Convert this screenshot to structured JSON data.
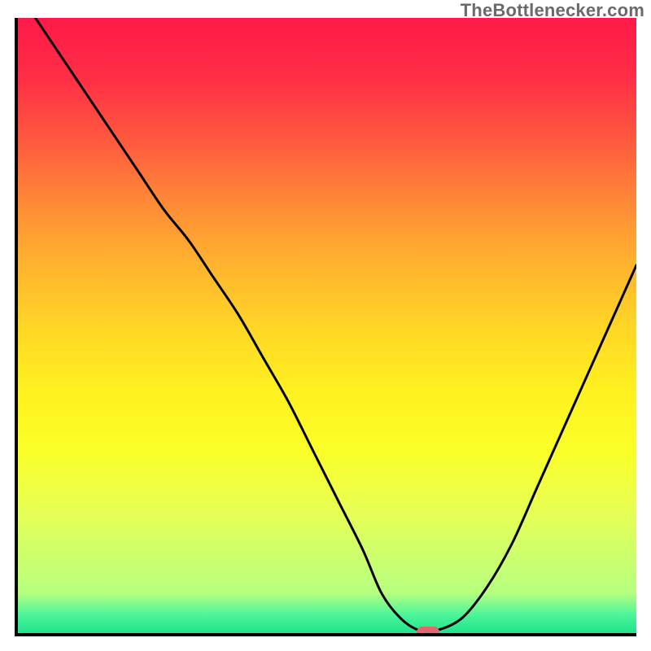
{
  "attribution": "TheBottlenecker.com",
  "colors": {
    "gradient": [
      "#ff1a49",
      "#ff2f45",
      "#ff5a3e",
      "#ff8a36",
      "#ffb42e",
      "#ffd626",
      "#fff01f",
      "#fbff28",
      "#e6ff55",
      "#b6ff80",
      "#4cf59a",
      "#17e089"
    ],
    "axis": "#000000",
    "curve": "#000000",
    "marker": "#e2676d",
    "attribution_text": "#6a6a6a"
  },
  "chart_data": {
    "type": "line",
    "title": "",
    "xlabel": "",
    "ylabel": "",
    "xlim": [
      0,
      100
    ],
    "ylim": [
      0,
      100
    ],
    "x": [
      0,
      4,
      8,
      12,
      16,
      20,
      24,
      28,
      32,
      36,
      40,
      44,
      48,
      52,
      56,
      59,
      62,
      65,
      68,
      72,
      76,
      80,
      84,
      88,
      92,
      96,
      100
    ],
    "values": [
      105,
      99,
      93,
      87,
      81,
      75,
      69,
      64,
      58,
      52,
      45,
      38,
      30,
      22,
      14,
      7,
      3,
      1,
      1,
      3,
      8,
      15,
      24,
      33,
      42,
      51,
      60
    ],
    "series": [
      {
        "name": "bottleneck-curve",
        "values": [
          105,
          99,
          93,
          87,
          81,
          75,
          69,
          64,
          58,
          52,
          45,
          38,
          30,
          22,
          14,
          7,
          3,
          1,
          1,
          3,
          8,
          15,
          24,
          33,
          42,
          51,
          60
        ]
      }
    ],
    "marker": {
      "x": 66.5,
      "y": 0.6
    },
    "grid": false,
    "legend_position": "none"
  }
}
